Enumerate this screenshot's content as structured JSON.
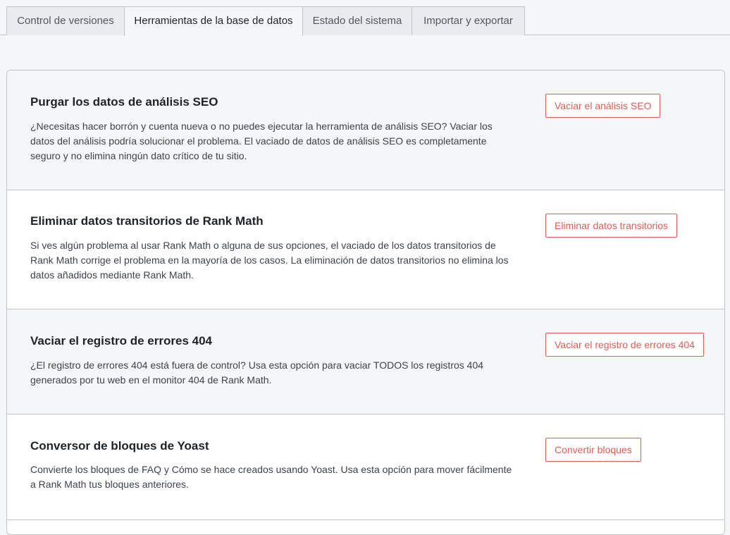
{
  "tabs": [
    {
      "label": "Control de versiones",
      "active": false
    },
    {
      "label": "Herramientas de la base de datos",
      "active": true
    },
    {
      "label": "Estado del sistema",
      "active": false
    },
    {
      "label": "Importar y exportar",
      "active": false
    }
  ],
  "sections": [
    {
      "title": "Purgar los datos de análisis SEO",
      "description": "¿Necesitas hacer borrón y cuenta nueva o no puedes ejecutar la herramienta de análisis SEO? Vaciar los datos del análisis podría solucionar el problema. El vaciado de datos de análisis SEO es completamente seguro y no elimina ningún dato crítico de tu sitio.",
      "button": "Vaciar el análisis SEO"
    },
    {
      "title": "Eliminar datos transitorios de Rank Math",
      "description": "Si ves algún problema al usar Rank Math o alguna de sus opciones, el vaciado de los datos transitorios de Rank Math corrige el problema en la mayoría de los casos. La eliminación de datos transitorios no elimina los datos añadidos mediante Rank Math.",
      "button": "Eliminar datos transitorios"
    },
    {
      "title": "Vaciar el registro de errores 404",
      "description": "¿El registro de errores 404 está fuera de control? Usa esta opción para vaciar TODOS los registros 404 generados por tu web en el monitor 404 de Rank Math.",
      "button": "Vaciar el registro de errores 404"
    },
    {
      "title": "Conversor de bloques de Yoast",
      "description": "Convierte los bloques de FAQ y Cómo se hace creados usando Yoast. Usa esta opción para mover fácilmente a Rank Math tus bloques anteriores.",
      "button": "Convertir bloques"
    }
  ],
  "colors": {
    "accent": "#e05d55",
    "border": "#c3c4c7",
    "shade": "#f5f6f7"
  }
}
